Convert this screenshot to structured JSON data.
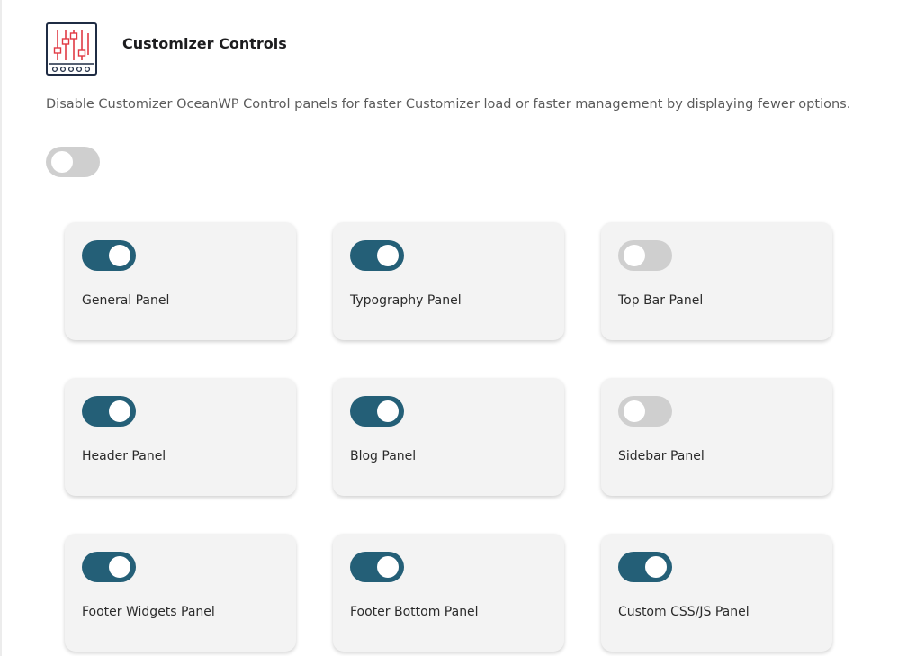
{
  "header": {
    "title": "Customizer Controls",
    "icon": "sliders-icon"
  },
  "description": "Disable Customizer OceanWP Control panels for faster Customizer load or faster management by displaying fewer options.",
  "master_toggle": {
    "on": false
  },
  "colors": {
    "toggle_on": "#245f77",
    "toggle_off": "#cfcfcf",
    "card_bg": "#f3f3f3",
    "icon_accent": "#e03a44",
    "icon_outline": "#1f2c44"
  },
  "panels": [
    {
      "label": "General Panel",
      "on": true
    },
    {
      "label": "Typography Panel",
      "on": true
    },
    {
      "label": "Top Bar Panel",
      "on": false
    },
    {
      "label": "Header Panel",
      "on": true
    },
    {
      "label": "Blog Panel",
      "on": true
    },
    {
      "label": "Sidebar Panel",
      "on": false
    },
    {
      "label": "Footer Widgets Panel",
      "on": true
    },
    {
      "label": "Footer Bottom Panel",
      "on": true
    },
    {
      "label": "Custom CSS/JS Panel",
      "on": true
    }
  ]
}
